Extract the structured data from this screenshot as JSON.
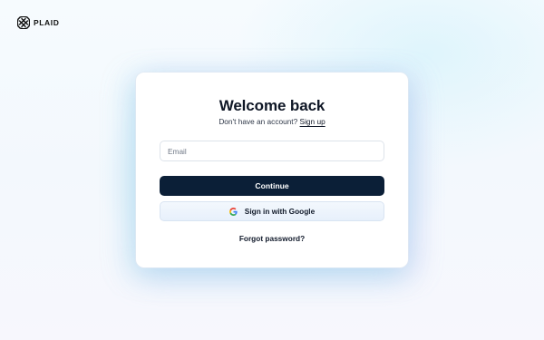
{
  "brand": {
    "name": "PLAID",
    "icon": "plaid-logo-icon"
  },
  "card": {
    "title": "Welcome back",
    "subtitle_text": "Don't have an account?",
    "signup_label": "Sign up"
  },
  "form": {
    "email_placeholder": "Email",
    "email_value": "",
    "continue_label": "Continue",
    "google_label": "Sign in with Google",
    "google_icon": "google-icon",
    "forgot_label": "Forgot password?"
  },
  "colors": {
    "primary_button": "#0b1f37",
    "text_dark": "#0f1726",
    "google_button_bg": "#eaf2fc"
  }
}
